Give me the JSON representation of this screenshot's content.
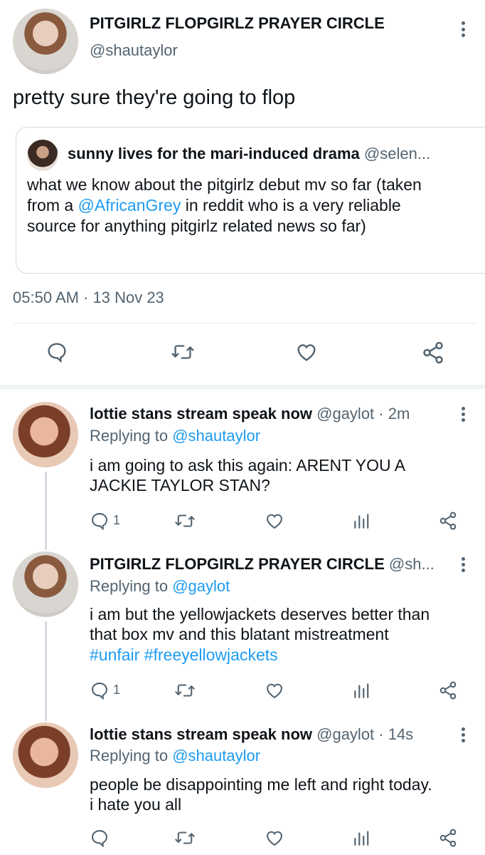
{
  "main_tweet": {
    "author_name": "PITGIRLZ FLOPGIRLZ PRAYER CIRCLE",
    "handle": "@shautaylor",
    "text": "pretty sure they're going to flop",
    "timestamp": "05:50 AM · 13 Nov 23",
    "quoted": {
      "author_name": "sunny lives for the mari-induced drama",
      "handle": "@selen...",
      "text_before": "what we know about the pitgirlz debut mv so far (taken from a ",
      "mention": "@AfricanGrey",
      "text_after": " in reddit who is a very reliable source for anything pitgirlz related news so far)"
    }
  },
  "replies": [
    {
      "author_name": "lottie stans stream speak now",
      "handle_time": "@gaylot · 2m",
      "replying_label": "Replying to",
      "replying_to": "@shautaylor",
      "text": "i am going to ask this again: AREN'T YOU A JACKIE TAYLOR STAN?",
      "text_line1": "i am going to ask this again: ARENT YOU A",
      "text_line2": "JACKIE TAYLOR STAN?",
      "reply_count": "1"
    },
    {
      "author_name": "PITGIRLZ FLOPGIRLZ PRAYER CIRCLE",
      "handle_time": "@sh...",
      "replying_label": "Replying to",
      "replying_to": "@gaylot",
      "text_line1": "i am but the yellowjackets deserves better than",
      "text_line2": "that box mv and this blatant mistreatment",
      "hashtags": "#unfair #freeyellowjackets",
      "reply_count": "1"
    },
    {
      "author_name": "lottie stans stream speak now",
      "handle_time": "@gaylot · 14s",
      "replying_label": "Replying to",
      "replying_to": "@shautaylor",
      "text_line1": "people be disappointing me left and right today.",
      "text_line2": "i hate you all",
      "reply_count": ""
    }
  ],
  "icons": {
    "reply": "reply-icon",
    "retweet": "retweet-icon",
    "like": "heart-icon",
    "share": "share-icon",
    "analytics": "analytics-icon",
    "more": "more-icon"
  },
  "colors": {
    "link": "#1d9bf0",
    "muted": "#536471",
    "text": "#0f1419"
  }
}
